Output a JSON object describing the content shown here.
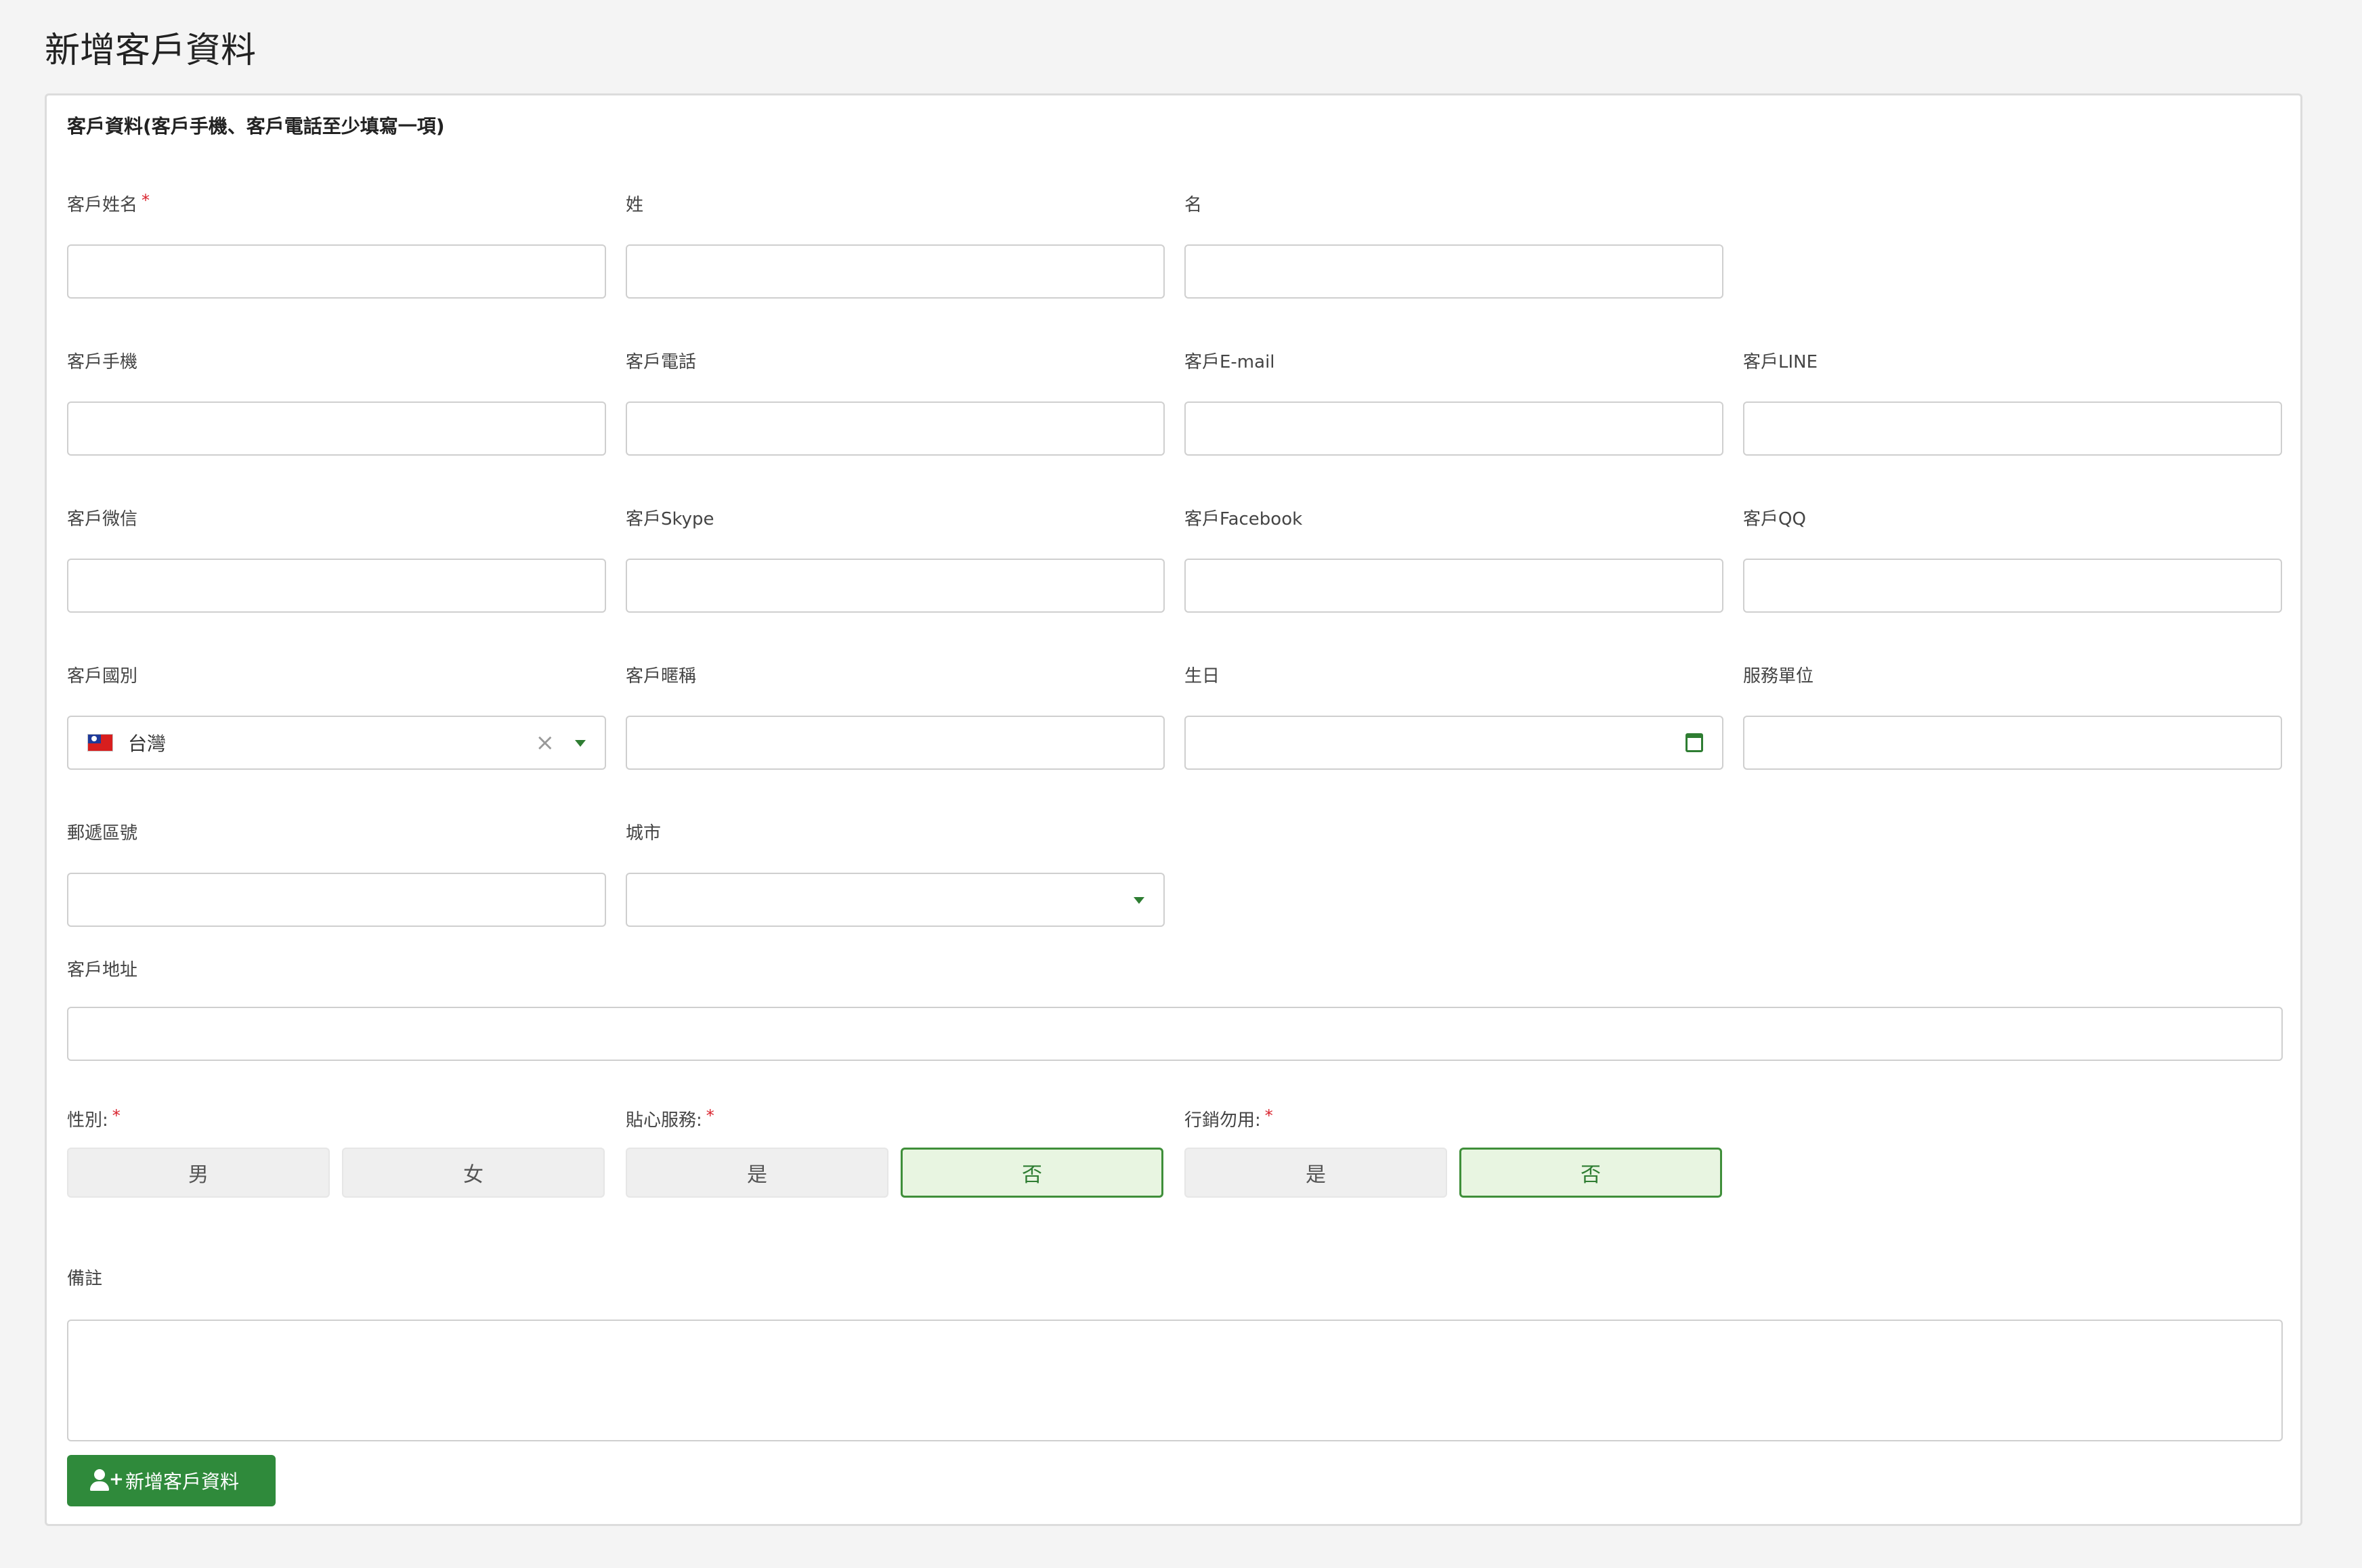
{
  "page": {
    "title": "新增客戶資料"
  },
  "form": {
    "heading": "客戶資料(客戶手機、客戶電話至少填寫一項)",
    "required_mark": "*",
    "fields": {
      "full_name": {
        "label": "客戶姓名",
        "value": ""
      },
      "last_name": {
        "label": "姓",
        "value": ""
      },
      "first_name": {
        "label": "名",
        "value": ""
      },
      "mobile": {
        "label": "客戶手機",
        "value": ""
      },
      "phone": {
        "label": "客戶電話",
        "value": ""
      },
      "email": {
        "label": "客戶E-mail",
        "value": ""
      },
      "line": {
        "label": "客戶LINE",
        "value": ""
      },
      "wechat": {
        "label": "客戶微信",
        "value": ""
      },
      "skype": {
        "label": "客戶Skype",
        "value": ""
      },
      "facebook": {
        "label": "客戶Facebook",
        "value": ""
      },
      "qq": {
        "label": "客戶QQ",
        "value": ""
      },
      "country": {
        "label": "客戶國別",
        "selected": "台灣",
        "clear": "×"
      },
      "nickname": {
        "label": "客戶暱稱",
        "value": ""
      },
      "birthday": {
        "label": "生日",
        "value": ""
      },
      "workplace": {
        "label": "服務單位",
        "value": ""
      },
      "postal_code": {
        "label": "郵遞區號",
        "value": ""
      },
      "city": {
        "label": "城市",
        "selected": ""
      },
      "address": {
        "label": "客戶地址",
        "value": ""
      },
      "notes": {
        "label": "備註",
        "value": ""
      }
    },
    "gender": {
      "label": "性別:",
      "options": [
        "男",
        "女"
      ],
      "selected_index": -1
    },
    "care_service": {
      "label": "貼心服務:",
      "options": [
        "是",
        "否"
      ],
      "selected_index": 1
    },
    "no_marketing": {
      "label": "行銷勿用:",
      "options": [
        "是",
        "否"
      ],
      "selected_index": 1
    },
    "submit_label": "新增客戶資料"
  },
  "colors": {
    "accent": "#2f8a3b",
    "selected_bg": "#e8f5e1",
    "required": "#d9232d"
  },
  "icons": {
    "country_flag": "taiwan-flag-icon",
    "birthday": "calendar-icon",
    "submit": "add-user-icon"
  }
}
